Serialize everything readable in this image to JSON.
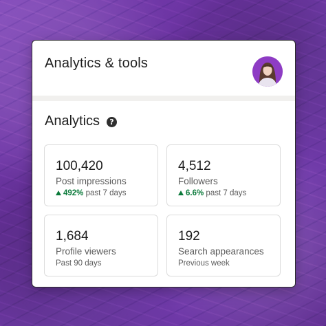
{
  "header": {
    "title": "Analytics & tools"
  },
  "section": {
    "title": "Analytics",
    "help_icon": "question-circle-icon"
  },
  "tiles": [
    {
      "value": "100,420",
      "label": "Post impressions",
      "trend": "492%",
      "period": "past 7 days"
    },
    {
      "value": "4,512",
      "label": "Followers",
      "trend": "6.6%",
      "period": "past 7 days"
    },
    {
      "value": "1,684",
      "label": "Profile viewers",
      "period": "Past 90 days"
    },
    {
      "value": "192",
      "label": "Search appearances",
      "period": "Previous week"
    }
  ],
  "colors": {
    "background": "#6f37a6",
    "trend_up": "#0a7a3a",
    "card": "#ffffff"
  }
}
